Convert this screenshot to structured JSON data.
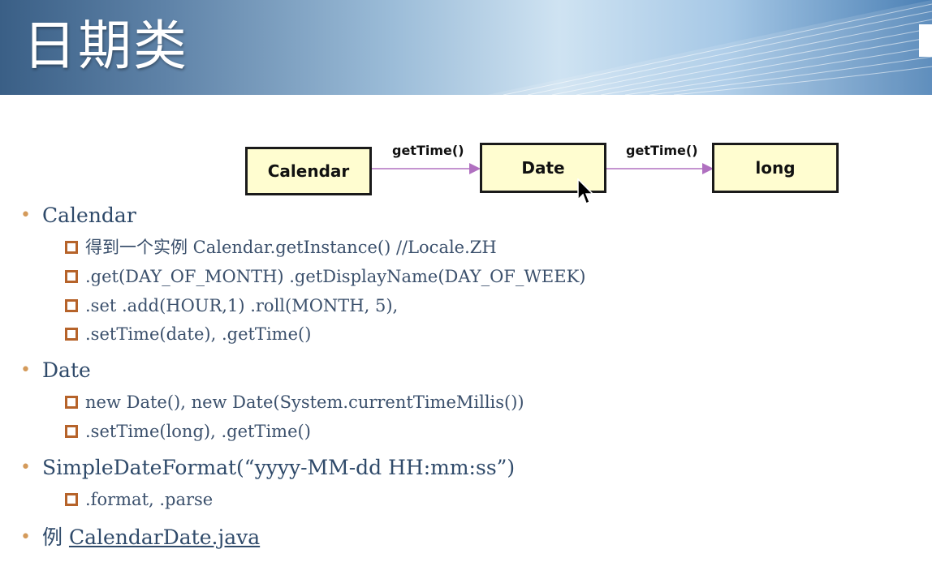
{
  "header": {
    "title": "日期类"
  },
  "diagram": {
    "boxes": [
      "Calendar",
      "Date",
      "long"
    ],
    "arrow_labels": [
      "getTime()",
      "getTime()"
    ]
  },
  "content": {
    "calendar": {
      "heading": "Calendar",
      "items": [
        "得到一个实例  Calendar.getInstance() //Locale.ZH",
        ".get(DAY_OF_MONTH)     .getDisplayName(DAY_OF_WEEK)",
        ".set          .add(HOUR,1)      .roll(MONTH, 5),",
        ".setTime(date),  .getTime()"
      ]
    },
    "date": {
      "heading": "Date",
      "items": [
        "new Date(),  new Date(System.currentTimeMillis())",
        ".setTime(long),  .getTime()"
      ]
    },
    "sdf": {
      "heading": "SimpleDateFormat(“yyyy-MM-dd HH:mm:ss”)",
      "items": [
        ".format,     .parse"
      ]
    },
    "example": {
      "prefix": "例 ",
      "link": "CalendarDate.java"
    }
  },
  "colors": {
    "box_fill": "#fffdd0",
    "arrow": "#b070c0",
    "bullet_dot": "#d49a5a",
    "sub_square": "#b6632a",
    "text": "#2f4a6a"
  },
  "icons": [
    "bullet-dot",
    "square-bullet-icon",
    "mouse-pointer-icon"
  ]
}
